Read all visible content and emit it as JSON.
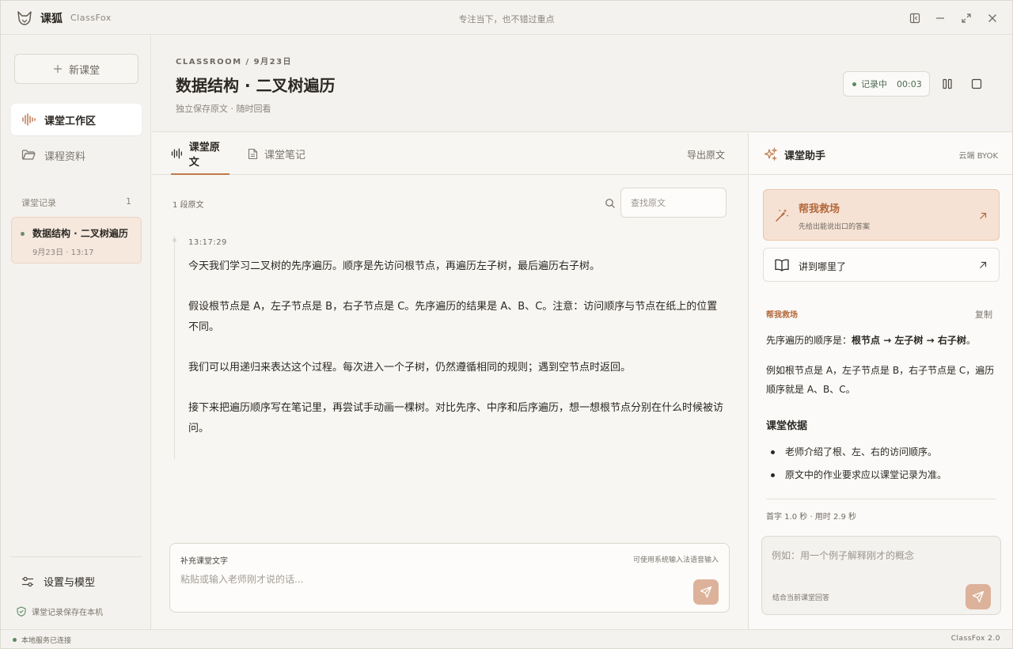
{
  "app": {
    "name": "课狐",
    "name_en": "ClassFox",
    "tagline": "专注当下，也不错过重点",
    "version": "ClassFox 2.0"
  },
  "colors": {
    "accent": "#c07a4e",
    "accent_soft": "#f6e2d4",
    "status_green": "#5a8a60",
    "send_button": "#ddb29a"
  },
  "sidebar": {
    "new_class_label": "新课堂",
    "nav": [
      {
        "label": "课堂工作区",
        "icon": "waveform-icon",
        "active": true
      },
      {
        "label": "课程资料",
        "icon": "folder-icon",
        "active": false
      }
    ],
    "records_label": "课堂记录",
    "records_count": "1",
    "records": [
      {
        "title": "数据结构 · 二叉树遍历",
        "date": "9月23日 · 13:17"
      }
    ],
    "settings_label": "设置与模型",
    "local_save_label": "课堂记录保存在本机"
  },
  "header": {
    "breadcrumb": "CLASSROOM / 9月23日",
    "title": "数据结构 · 二叉树遍历",
    "subtitle": "独立保存原文 · 随时回看",
    "recording_label": "记录中",
    "recording_time": "00:03"
  },
  "transcript": {
    "tabs": [
      {
        "label": "课堂原文",
        "active": true
      },
      {
        "label": "课堂笔记",
        "active": false
      }
    ],
    "export_label": "导出原文",
    "segment_count": "1 段原文",
    "search_placeholder": "查找原文",
    "timestamp": "13:17:29",
    "paragraphs": [
      "今天我们学习二叉树的先序遍历。顺序是先访问根节点，再遍历左子树，最后遍历右子树。",
      "假设根节点是 A，左子节点是 B，右子节点是 C。先序遍历的结果是 A、B、C。注意：访问顺序与节点在纸上的位置不同。",
      "我们可以用递归来表达这个过程。每次进入一个子树，仍然遵循相同的规则；遇到空节点时返回。",
      "接下来把遍历顺序写在笔记里，再尝试手动画一棵树。对比先序、中序和后序遍历，想一想根节点分别在什么时候被访问。"
    ],
    "supplement_label": "补充课堂文字",
    "supplement_hint": "可使用系统输入法语音输入",
    "supplement_placeholder": "粘贴或输入老师刚才说的话..."
  },
  "assistant": {
    "title": "课堂助手",
    "badge": "云端 BYOK",
    "rescue_title": "帮我救场",
    "rescue_subtitle": "先给出能说出口的答案",
    "where_label": "讲到哪里了",
    "answer_tag": "帮我救场",
    "copy_label": "复制",
    "answer_prefix": "先序遍历的顺序是：",
    "answer_bold": "根节点 → 左子树 → 右子树",
    "answer_suffix": "。",
    "answer_example": "例如根节点是 A，左子节点是 B，右子节点是 C，遍历顺序就是 A、B、C。",
    "basis_title": "课堂依据",
    "basis_items": [
      "老师介绍了根、左、右的访问顺序。",
      "原文中的作业要求应以课堂记录为准。"
    ],
    "metrics": "首字 1.0 秒 · 用时 2.9 秒",
    "ask_placeholder": "例如：用一个例子解释刚才的概念",
    "ask_hint": "结合当前课堂回答"
  },
  "status": {
    "connection": "本地服务已连接"
  }
}
